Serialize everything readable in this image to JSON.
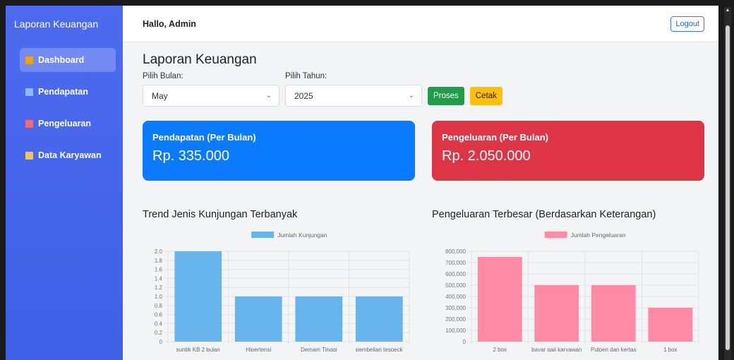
{
  "sidebar": {
    "brand": "Laporan Keuangan",
    "items": [
      {
        "label": "Dashboard",
        "active": true,
        "icon": "bar-chart-icon",
        "icon_color": "#f0a020"
      },
      {
        "label": "Pendapatan",
        "active": false,
        "icon": "chart-up-icon",
        "icon_color": "#8fb8f8"
      },
      {
        "label": "Pengeluaran",
        "active": false,
        "icon": "chart-down-icon",
        "icon_color": "#f06a7a"
      },
      {
        "label": "Data Karyawan",
        "active": false,
        "icon": "clipboard-icon",
        "icon_color": "#f2c45a"
      }
    ]
  },
  "header": {
    "greeting": "Hallo, Admin",
    "logout_label": "Logout"
  },
  "main": {
    "title": "Laporan Keuangan",
    "month_label": "Pilih Bulan:",
    "month_value": "May",
    "year_label": "Pilih Tahun:",
    "year_value": "2025",
    "process_label": "Proses",
    "print_label": "Cetak"
  },
  "cards": {
    "income_title": "Pendapatan (Per Bulan)",
    "income_value": "Rp. 335.000",
    "expense_title": "Pengeluaran (Per Bulan)",
    "expense_value": "Rp. 2.050.000"
  },
  "colors": {
    "sidebar": "#4d6bef",
    "income": "#0a7bff",
    "expense": "#dd3545",
    "bar_blue": "#67b3eb",
    "bar_pink": "#ff8aa5"
  },
  "chart_data": [
    {
      "type": "bar",
      "title": "Trend Jenis Kunjungan Terbanyak",
      "categories": [
        "suntik KB 2 bulan",
        "Hipertensi",
        "Demam Tinggi",
        "pembelian tespeck"
      ],
      "series": [
        {
          "name": "Jumlah Kunjungan",
          "values": [
            2,
            1,
            1,
            1
          ]
        }
      ],
      "ylim": [
        0,
        2
      ],
      "yticks": [
        "0",
        "0.2",
        "0.4",
        "0.6",
        "0.8",
        "1.0",
        "1.2",
        "1.4",
        "1.6",
        "1.8",
        "2.0"
      ],
      "color": "#67b3eb",
      "legend": "top",
      "grid": true
    },
    {
      "type": "bar",
      "title": "Pengeluaran Terbesar (Berdasarkan Keterangan)",
      "categories": [
        "2 box",
        "bayar gaji karyawan",
        "Pulpen dan kertas",
        "1 box"
      ],
      "series": [
        {
          "name": "Jumlah Pengeluaran",
          "values": [
            750000,
            500000,
            500000,
            300000
          ]
        }
      ],
      "ylim": [
        0,
        800000
      ],
      "yticks": [
        "0",
        "100,000",
        "200,000",
        "300,000",
        "400,000",
        "500,000",
        "600,000",
        "700,000",
        "800,000"
      ],
      "color": "#ff8aa5",
      "legend": "top",
      "grid": true
    }
  ]
}
